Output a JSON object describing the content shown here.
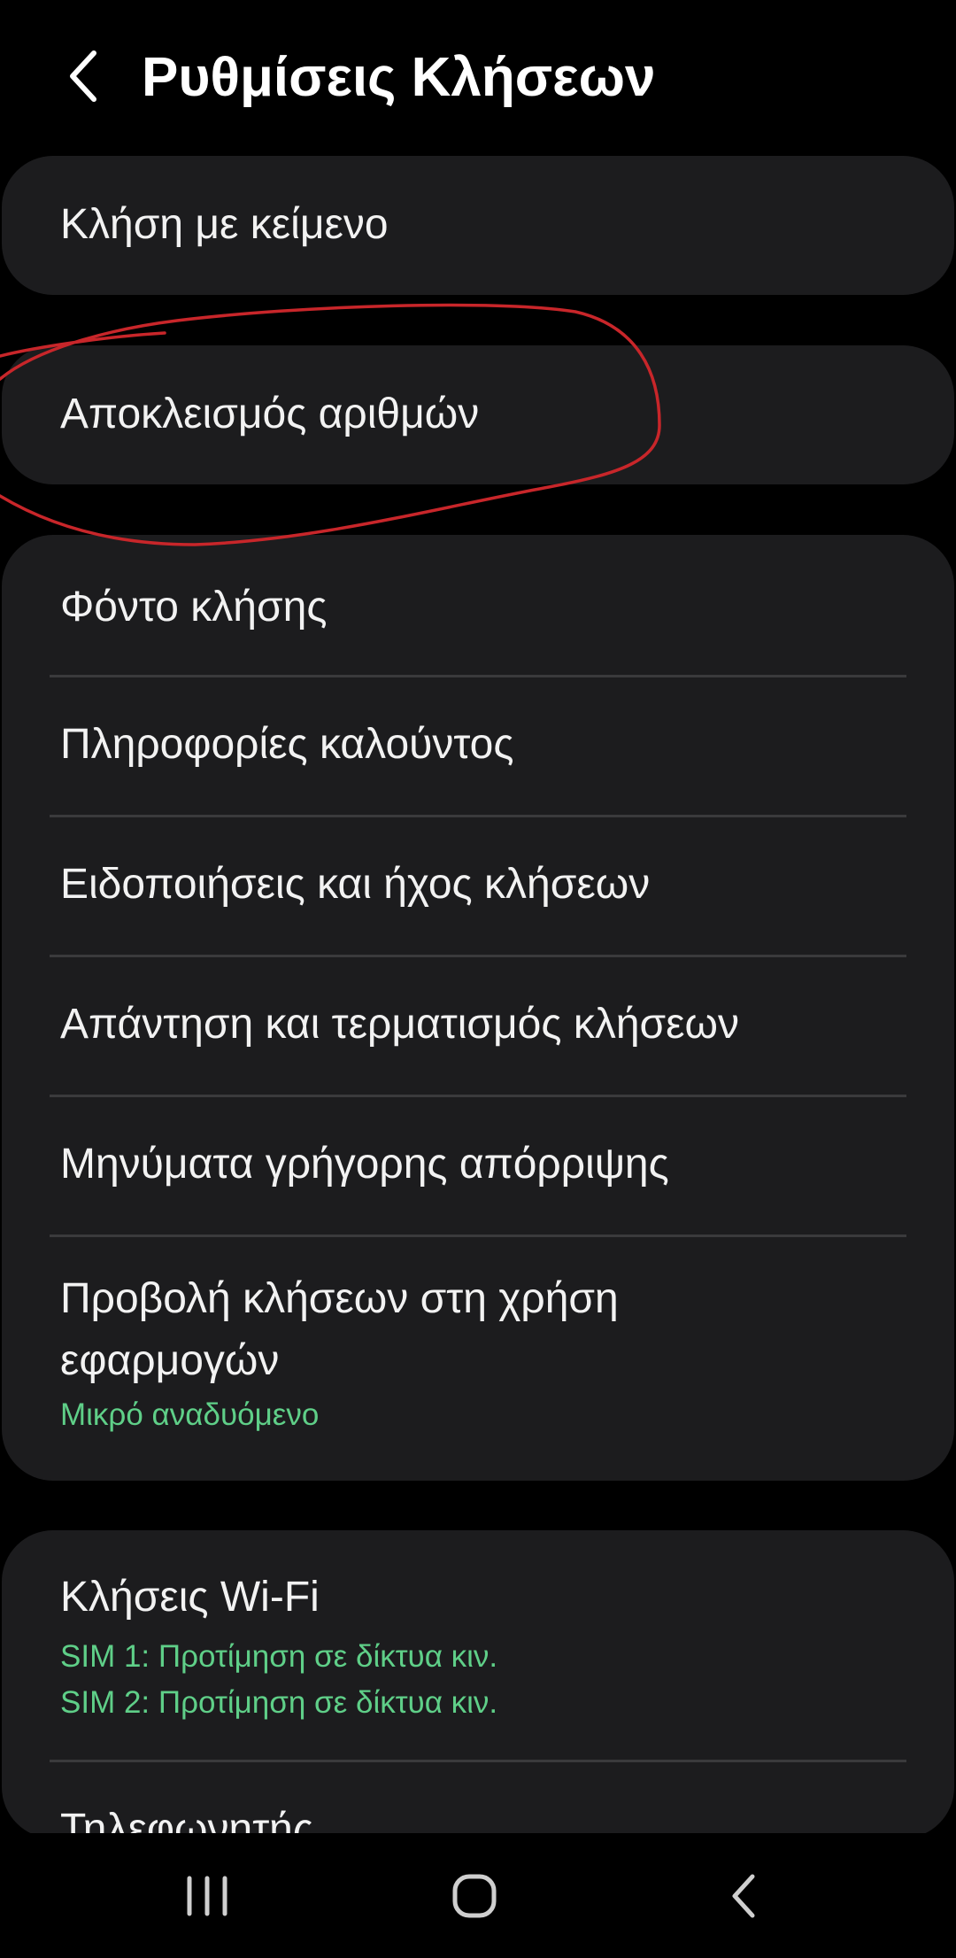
{
  "header": {
    "title": "Ρυθμίσεις Κλήσεων",
    "back_icon": "chevron-left-icon"
  },
  "card_text_call": {
    "label": "Κλήση με κείμενο"
  },
  "card_block": {
    "label": "Αποκλεισμός αριθμών"
  },
  "card_main": {
    "items": [
      {
        "label": "Φόντο κλήσης"
      },
      {
        "label": "Πληροφορίες καλούντος"
      },
      {
        "label": "Ειδοποιήσεις και ήχος κλήσεων"
      },
      {
        "label": "Απάντηση και τερματισμός κλήσεων"
      },
      {
        "label": "Μηνύματα γρήγορης απόρριψης"
      },
      {
        "label_line1": "Προβολή κλήσεων στη χρήση",
        "label_line2": "εφαρμογών",
        "sub": "Μικρό αναδυόμενο"
      }
    ]
  },
  "card_wifi": {
    "items": [
      {
        "label": "Κλήσεις Wi-Fi",
        "sub1": "SIM 1: Προτίμηση σε δίκτυα κιν.",
        "sub2": "SIM 2: Προτίμηση σε δίκτυα κιν."
      },
      {
        "label": "Τηλεφωνητής"
      }
    ]
  },
  "nav": {
    "recents_icon": "recent-apps-icon",
    "home_icon": "home-icon",
    "back_icon": "back-icon"
  },
  "colors": {
    "background": "#000000",
    "card": "#1c1c1e",
    "text": "#f2f2f2",
    "accent_green": "#5fcf88",
    "annotation_red": "#c8262a",
    "divider": "#3a3a3c"
  }
}
